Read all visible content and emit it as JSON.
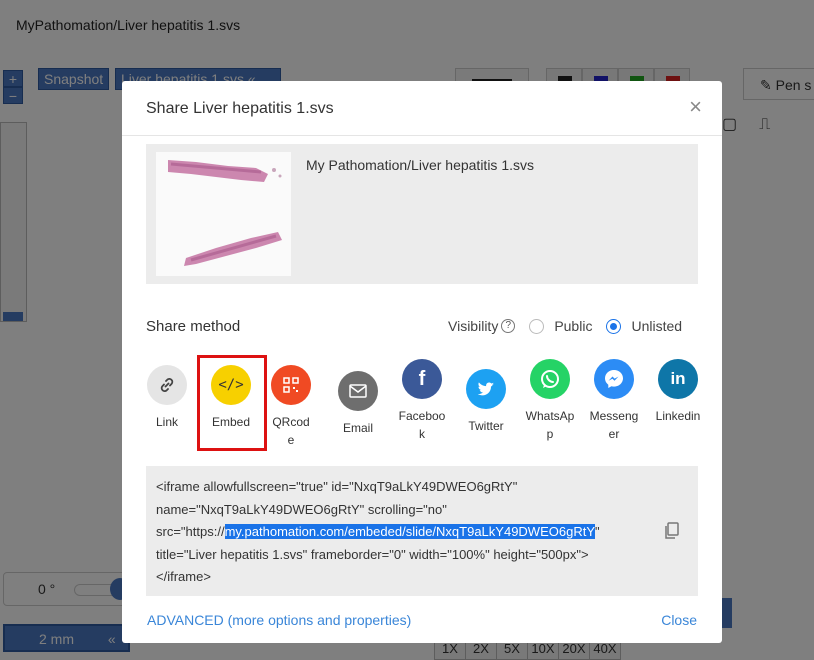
{
  "background": {
    "title": "MyPathomation/Liver hepatitis 1.svs",
    "zoom_in": "+",
    "zoom_out": "−",
    "snapshot_label": "Snapshot",
    "file_label": "Liver hepatitis 1.svs",
    "file_arrow": "«",
    "pen_label": "Pen s",
    "rotation_value": "0 °",
    "scale_label": "2 mm",
    "scale_arrow": "«",
    "magnifications": [
      "1X",
      "2X",
      "5X",
      "10X",
      "20X",
      "40X"
    ],
    "swatch_colors": [
      "#222222",
      "#2222cc",
      "#22aa22",
      "#dd2222"
    ]
  },
  "modal": {
    "title": "Share Liver hepatitis 1.svs",
    "close_icon": "×",
    "slide_path": "My Pathomation/Liver hepatitis 1.svs",
    "share_method_label": "Share method",
    "visibility_label": "Visibility",
    "visibility_help": "?",
    "visibility_options": [
      {
        "label": "Public",
        "checked": false
      },
      {
        "label": "Unlisted",
        "checked": true
      }
    ],
    "share_items": [
      {
        "label": "Link",
        "icon": "link-icon",
        "color": "#e5e5e5"
      },
      {
        "label": "Embed",
        "icon": "embed-icon",
        "color": "#f7d000",
        "selected": true
      },
      {
        "label": "QRcode",
        "icon": "qrcode-icon",
        "color": "#f04a23"
      },
      {
        "label": "Email",
        "icon": "email-icon",
        "color": "#6e6e6e"
      },
      {
        "label": "Facebook",
        "icon": "facebook-icon",
        "color": "#3b5998"
      },
      {
        "label": "Twitter",
        "icon": "twitter-icon",
        "color": "#1da1f2"
      },
      {
        "label": "WhatsApp",
        "icon": "whatsapp-icon",
        "color": "#25d366"
      },
      {
        "label": "Messenger",
        "icon": "messenger-icon",
        "color": "#2c8cf5"
      },
      {
        "label": "Linkedin",
        "icon": "linkedin-icon",
        "color": "#0e76a8"
      }
    ],
    "embed_code": {
      "line1": "<iframe allowfullscreen=\"true\" id=\"NxqT9aLkY49DWEO6gRtY\"",
      "line2": "name=\"NxqT9aLkY49DWEO6gRtY\" scrolling=\"no\"",
      "line3_prefix": "src=\"https://",
      "line3_highlight": "my.pathomation.com/embeded/slide/NxqT9aLkY49DWEO6gRtY",
      "line3_suffix": "\"",
      "line4": "title=\"Liver hepatitis 1.svs\" frameborder=\"0\" width=\"100%\" height=\"500px\">",
      "line5": "</iframe>"
    },
    "advanced_link": "ADVANCED (more options and properties)",
    "close_link": "Close"
  }
}
